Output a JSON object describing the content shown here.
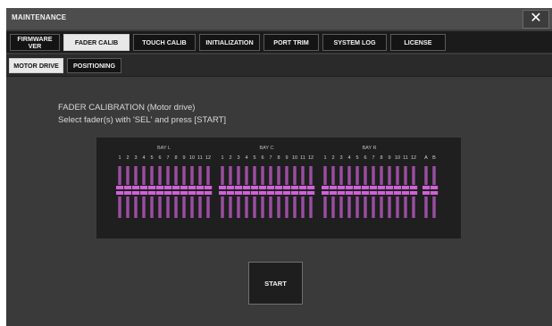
{
  "window": {
    "title": "MAINTENANCE"
  },
  "tabs": [
    {
      "line1": "FIRMWARE",
      "line2": "VER",
      "selected": false
    },
    {
      "line1": "FADER CALIB",
      "line2": "",
      "selected": true
    },
    {
      "line1": "TOUCH CALIB",
      "line2": "",
      "selected": false
    },
    {
      "line1": "INITIALIZATION",
      "line2": "",
      "selected": false
    },
    {
      "line1": "PORT TRIM",
      "line2": "",
      "selected": false
    },
    {
      "line1": "SYSTEM LOG",
      "line2": "",
      "selected": false
    },
    {
      "line1": "LICENSE",
      "line2": "",
      "selected": false
    }
  ],
  "subtabs": [
    {
      "label": "MOTOR DRIVE",
      "selected": true
    },
    {
      "label": "POSITIONING",
      "selected": false
    }
  ],
  "instructions": {
    "line1": "FADER CALIBRATION (Motor drive)",
    "line2": "Select fader(s) with 'SEL' and press [START]"
  },
  "bays": [
    {
      "name": "BAY L",
      "labels": [
        "1",
        "2",
        "3",
        "4",
        "5",
        "6",
        "7",
        "8",
        "9",
        "10",
        "11",
        "12"
      ]
    },
    {
      "name": "BAY C",
      "labels": [
        "1",
        "2",
        "3",
        "4",
        "5",
        "6",
        "7",
        "8",
        "9",
        "10",
        "11",
        "12"
      ]
    },
    {
      "name": "BAY R",
      "labels": [
        "1",
        "2",
        "3",
        "4",
        "5",
        "6",
        "7",
        "8",
        "9",
        "10",
        "11",
        "12"
      ]
    },
    {
      "name": "",
      "labels": [
        "A",
        "B"
      ]
    }
  ],
  "fader_color": "#cf63d8",
  "start_label": "START"
}
